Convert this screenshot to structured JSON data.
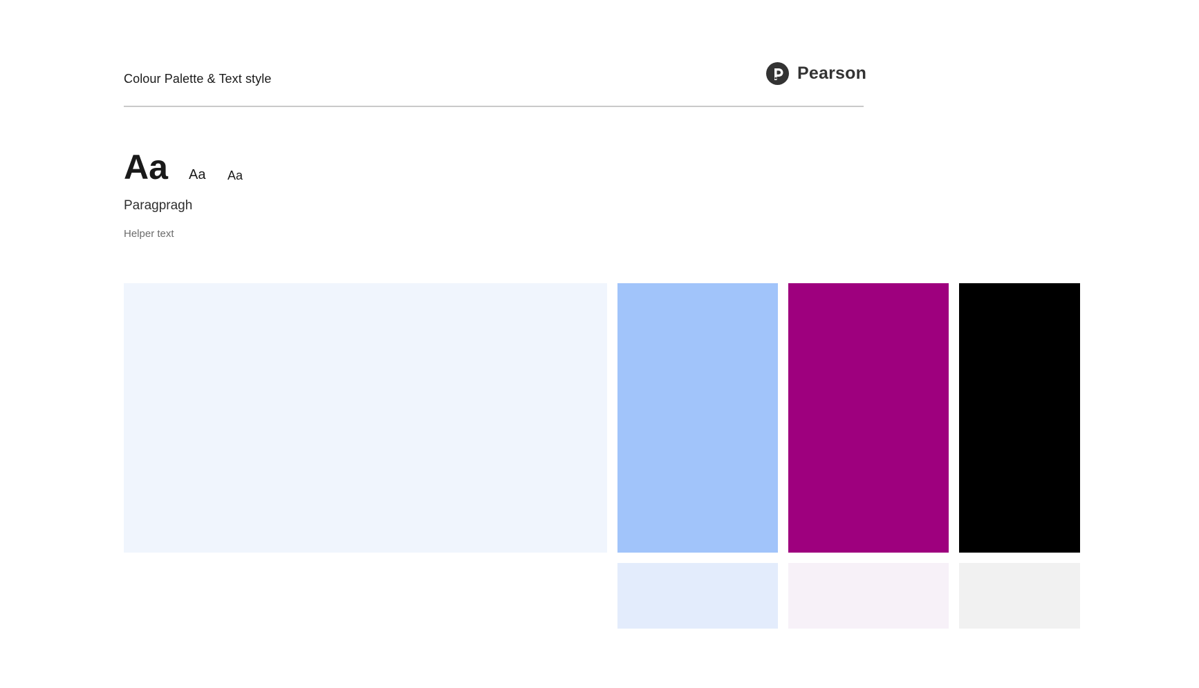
{
  "header": {
    "title": "Colour Palette & Text style",
    "brand": {
      "icon": "pearson-logo-icon",
      "name": "Pearson",
      "color": "#333333"
    }
  },
  "typography": {
    "heading_large": "Aa",
    "heading_medium": "Aa",
    "heading_small": "Aa",
    "paragraph": "Paragpragh",
    "helper": "Helper text"
  },
  "palette": {
    "primary_light": "#F0F5FD",
    "blue": "#A1C4FA",
    "magenta": "#9E007E",
    "black": "#000000",
    "blue_tint": "#E3ECFC",
    "magenta_tint": "#F7F1F8",
    "grey_tint": "#F1F1F1"
  }
}
